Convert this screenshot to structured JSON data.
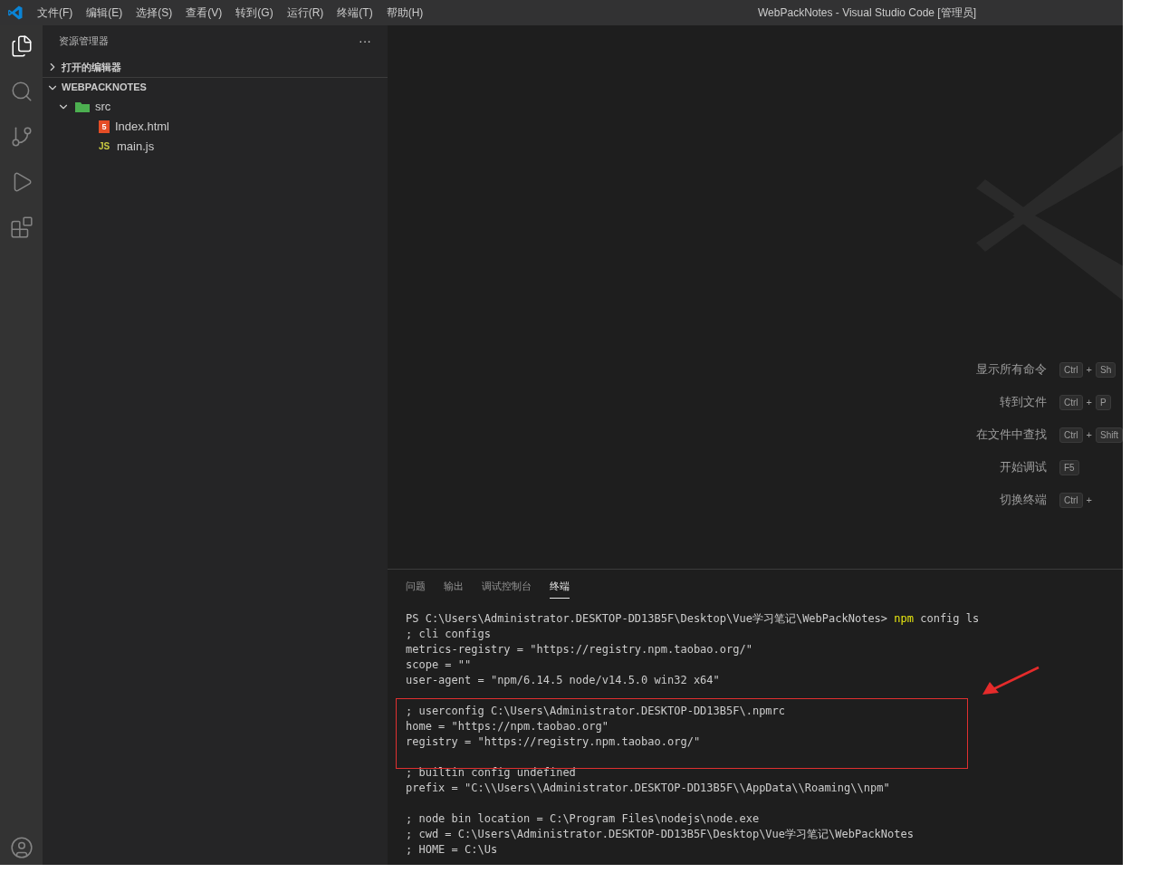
{
  "window": {
    "title": "WebPackNotes - Visual Studio Code [管理员]"
  },
  "menu": [
    "文件(F)",
    "编辑(E)",
    "选择(S)",
    "查看(V)",
    "转到(G)",
    "运行(R)",
    "终端(T)",
    "帮助(H)"
  ],
  "activity_bar": [
    {
      "kind": "files",
      "selected": true
    },
    {
      "kind": "search",
      "selected": false
    },
    {
      "kind": "source-control",
      "selected": false
    },
    {
      "kind": "run",
      "selected": false
    },
    {
      "kind": "extensions",
      "selected": false
    }
  ],
  "sidebar": {
    "title": "资源管理器",
    "more": "···",
    "sections": [
      {
        "label": "打开的编辑器",
        "expanded": false
      },
      {
        "label": "WEBPACKNOTES",
        "expanded": true
      }
    ],
    "tree": [
      {
        "label": "src",
        "kind": "folder",
        "expanded": true,
        "children": [
          {
            "label": "Index.html",
            "kind": "html",
            "badge": "5"
          },
          {
            "label": "main.js",
            "kind": "js",
            "badge": "JS"
          }
        ]
      }
    ]
  },
  "shortcuts": [
    {
      "label": "显示所有命令",
      "keys": [
        "Ctrl",
        "+",
        "Sh"
      ]
    },
    {
      "label": "转到文件",
      "keys": [
        "Ctrl",
        "+",
        "P"
      ]
    },
    {
      "label": "在文件中查找",
      "keys": [
        "Ctrl",
        "+",
        "Shift"
      ]
    },
    {
      "label": "开始调试",
      "keys": [
        "F5"
      ]
    },
    {
      "label": "切换终端",
      "keys": [
        "Ctrl",
        "+"
      ]
    }
  ],
  "panel": {
    "tabs": [
      {
        "label": "问题",
        "selected": false
      },
      {
        "label": "输出",
        "selected": false
      },
      {
        "label": "调试控制台",
        "selected": false
      },
      {
        "label": "终端",
        "selected": true
      }
    ],
    "terminal": [
      {
        "kind": "prompt",
        "text": "PS C:\\Users\\Administrator.DESKTOP-DD13B5F\\Desktop\\Vue学习笔记\\WebPackNotes>",
        "command": "npm",
        "args": " config ls"
      },
      {
        "kind": "line",
        "text": "; cli configs"
      },
      {
        "kind": "line",
        "text": "metrics-registry = \"https://registry.npm.taobao.org/\""
      },
      {
        "kind": "line",
        "text": "scope = \"\""
      },
      {
        "kind": "line",
        "text": "user-agent = \"npm/6.14.5 node/v14.5.0 win32 x64\""
      },
      {
        "kind": "blank"
      },
      {
        "kind": "line",
        "text": "; userconfig C:\\Users\\Administrator.DESKTOP-DD13B5F\\.npmrc"
      },
      {
        "kind": "line",
        "text": "home = \"https://npm.taobao.org\""
      },
      {
        "kind": "line",
        "text": "registry = \"https://registry.npm.taobao.org/\""
      },
      {
        "kind": "blank"
      },
      {
        "kind": "line",
        "text": "; builtin config undefined"
      },
      {
        "kind": "line",
        "text": "prefix = \"C:\\\\Users\\\\Administrator.DESKTOP-DD13B5F\\\\AppData\\\\Roaming\\\\npm\""
      },
      {
        "kind": "blank"
      },
      {
        "kind": "line",
        "text": "; node bin location = C:\\Program Files\\nodejs\\node.exe"
      },
      {
        "kind": "line",
        "text": "; cwd = C:\\Users\\Administrator.DESKTOP-DD13B5F\\Desktop\\Vue学习笔记\\WebPackNotes"
      },
      {
        "kind": "line",
        "text": "; HOME = C:\\Us"
      }
    ]
  }
}
